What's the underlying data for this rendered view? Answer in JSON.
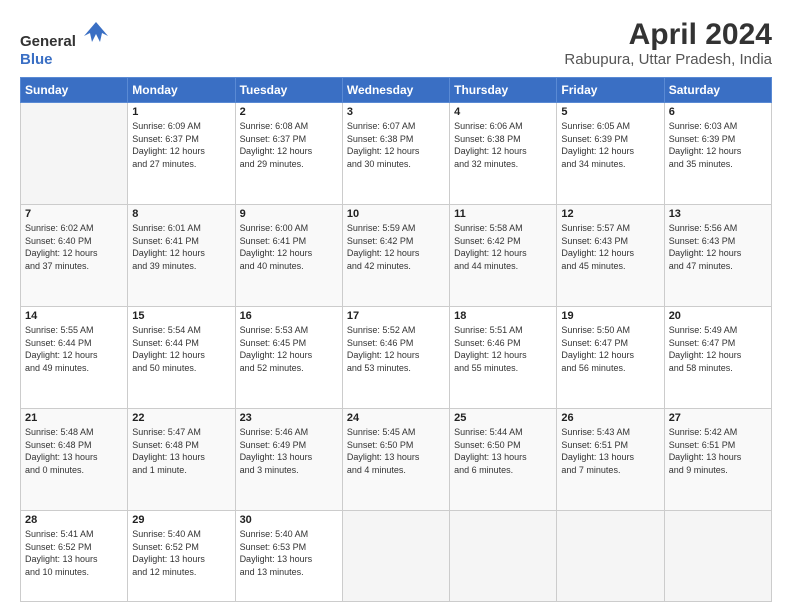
{
  "header": {
    "logo_general": "General",
    "logo_blue": "Blue",
    "title": "April 2024",
    "location": "Rabupura, Uttar Pradesh, India"
  },
  "weekdays": [
    "Sunday",
    "Monday",
    "Tuesday",
    "Wednesday",
    "Thursday",
    "Friday",
    "Saturday"
  ],
  "weeks": [
    [
      {
        "day": "",
        "info": ""
      },
      {
        "day": "1",
        "info": "Sunrise: 6:09 AM\nSunset: 6:37 PM\nDaylight: 12 hours\nand 27 minutes."
      },
      {
        "day": "2",
        "info": "Sunrise: 6:08 AM\nSunset: 6:37 PM\nDaylight: 12 hours\nand 29 minutes."
      },
      {
        "day": "3",
        "info": "Sunrise: 6:07 AM\nSunset: 6:38 PM\nDaylight: 12 hours\nand 30 minutes."
      },
      {
        "day": "4",
        "info": "Sunrise: 6:06 AM\nSunset: 6:38 PM\nDaylight: 12 hours\nand 32 minutes."
      },
      {
        "day": "5",
        "info": "Sunrise: 6:05 AM\nSunset: 6:39 PM\nDaylight: 12 hours\nand 34 minutes."
      },
      {
        "day": "6",
        "info": "Sunrise: 6:03 AM\nSunset: 6:39 PM\nDaylight: 12 hours\nand 35 minutes."
      }
    ],
    [
      {
        "day": "7",
        "info": "Sunrise: 6:02 AM\nSunset: 6:40 PM\nDaylight: 12 hours\nand 37 minutes."
      },
      {
        "day": "8",
        "info": "Sunrise: 6:01 AM\nSunset: 6:41 PM\nDaylight: 12 hours\nand 39 minutes."
      },
      {
        "day": "9",
        "info": "Sunrise: 6:00 AM\nSunset: 6:41 PM\nDaylight: 12 hours\nand 40 minutes."
      },
      {
        "day": "10",
        "info": "Sunrise: 5:59 AM\nSunset: 6:42 PM\nDaylight: 12 hours\nand 42 minutes."
      },
      {
        "day": "11",
        "info": "Sunrise: 5:58 AM\nSunset: 6:42 PM\nDaylight: 12 hours\nand 44 minutes."
      },
      {
        "day": "12",
        "info": "Sunrise: 5:57 AM\nSunset: 6:43 PM\nDaylight: 12 hours\nand 45 minutes."
      },
      {
        "day": "13",
        "info": "Sunrise: 5:56 AM\nSunset: 6:43 PM\nDaylight: 12 hours\nand 47 minutes."
      }
    ],
    [
      {
        "day": "14",
        "info": "Sunrise: 5:55 AM\nSunset: 6:44 PM\nDaylight: 12 hours\nand 49 minutes."
      },
      {
        "day": "15",
        "info": "Sunrise: 5:54 AM\nSunset: 6:44 PM\nDaylight: 12 hours\nand 50 minutes."
      },
      {
        "day": "16",
        "info": "Sunrise: 5:53 AM\nSunset: 6:45 PM\nDaylight: 12 hours\nand 52 minutes."
      },
      {
        "day": "17",
        "info": "Sunrise: 5:52 AM\nSunset: 6:46 PM\nDaylight: 12 hours\nand 53 minutes."
      },
      {
        "day": "18",
        "info": "Sunrise: 5:51 AM\nSunset: 6:46 PM\nDaylight: 12 hours\nand 55 minutes."
      },
      {
        "day": "19",
        "info": "Sunrise: 5:50 AM\nSunset: 6:47 PM\nDaylight: 12 hours\nand 56 minutes."
      },
      {
        "day": "20",
        "info": "Sunrise: 5:49 AM\nSunset: 6:47 PM\nDaylight: 12 hours\nand 58 minutes."
      }
    ],
    [
      {
        "day": "21",
        "info": "Sunrise: 5:48 AM\nSunset: 6:48 PM\nDaylight: 13 hours\nand 0 minutes."
      },
      {
        "day": "22",
        "info": "Sunrise: 5:47 AM\nSunset: 6:48 PM\nDaylight: 13 hours\nand 1 minute."
      },
      {
        "day": "23",
        "info": "Sunrise: 5:46 AM\nSunset: 6:49 PM\nDaylight: 13 hours\nand 3 minutes."
      },
      {
        "day": "24",
        "info": "Sunrise: 5:45 AM\nSunset: 6:50 PM\nDaylight: 13 hours\nand 4 minutes."
      },
      {
        "day": "25",
        "info": "Sunrise: 5:44 AM\nSunset: 6:50 PM\nDaylight: 13 hours\nand 6 minutes."
      },
      {
        "day": "26",
        "info": "Sunrise: 5:43 AM\nSunset: 6:51 PM\nDaylight: 13 hours\nand 7 minutes."
      },
      {
        "day": "27",
        "info": "Sunrise: 5:42 AM\nSunset: 6:51 PM\nDaylight: 13 hours\nand 9 minutes."
      }
    ],
    [
      {
        "day": "28",
        "info": "Sunrise: 5:41 AM\nSunset: 6:52 PM\nDaylight: 13 hours\nand 10 minutes."
      },
      {
        "day": "29",
        "info": "Sunrise: 5:40 AM\nSunset: 6:52 PM\nDaylight: 13 hours\nand 12 minutes."
      },
      {
        "day": "30",
        "info": "Sunrise: 5:40 AM\nSunset: 6:53 PM\nDaylight: 13 hours\nand 13 minutes."
      },
      {
        "day": "",
        "info": ""
      },
      {
        "day": "",
        "info": ""
      },
      {
        "day": "",
        "info": ""
      },
      {
        "day": "",
        "info": ""
      }
    ]
  ]
}
